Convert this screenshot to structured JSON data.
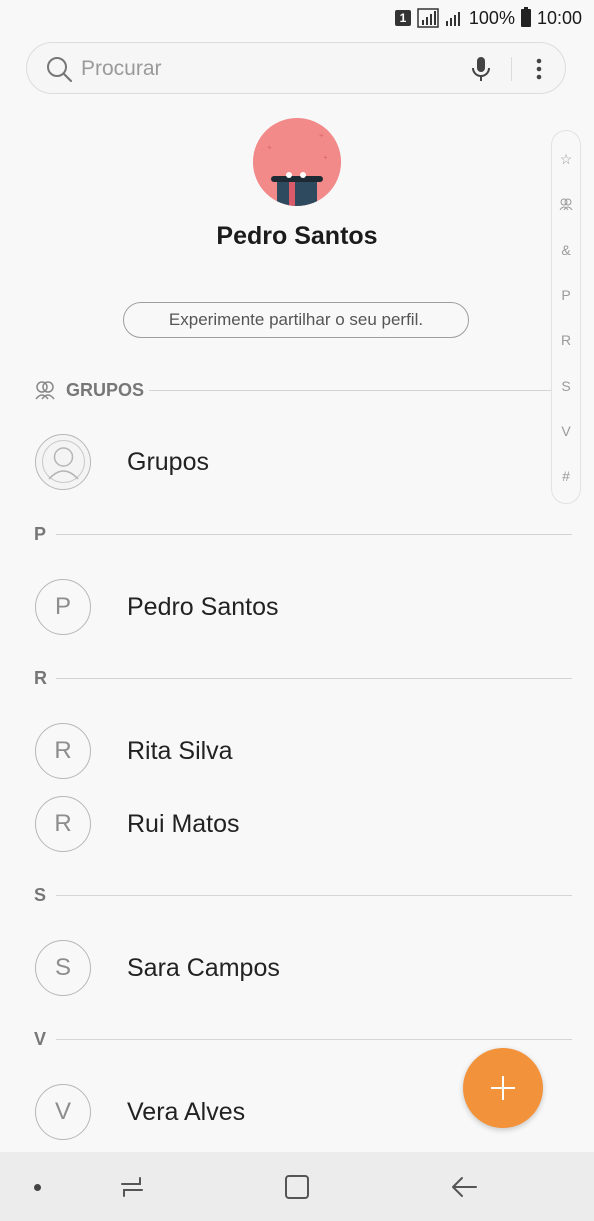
{
  "status_bar": {
    "sim": "1",
    "battery": "100%",
    "time": "10:00"
  },
  "search": {
    "placeholder": "Procurar"
  },
  "profile": {
    "name": "Pedro Santos",
    "share_label": "Experimente partilhar o seu perfil."
  },
  "groups": {
    "header": "GRUPOS",
    "item_label": "Grupos"
  },
  "sections": [
    {
      "letter": "P",
      "contacts": [
        {
          "initial": "P",
          "name": "Pedro Santos"
        }
      ]
    },
    {
      "letter": "R",
      "contacts": [
        {
          "initial": "R",
          "name": "Rita Silva"
        },
        {
          "initial": "R",
          "name": "Rui Matos"
        }
      ]
    },
    {
      "letter": "S",
      "contacts": [
        {
          "initial": "S",
          "name": "Sara Campos"
        }
      ]
    },
    {
      "letter": "V",
      "contacts": [
        {
          "initial": "V",
          "name": "Vera Alves"
        }
      ]
    }
  ],
  "index_scroller": [
    "☆",
    "group-icon",
    "&",
    "P",
    "R",
    "S",
    "V",
    "#"
  ],
  "colors": {
    "accent": "#f2923a",
    "avatar": "#f28a8a"
  }
}
